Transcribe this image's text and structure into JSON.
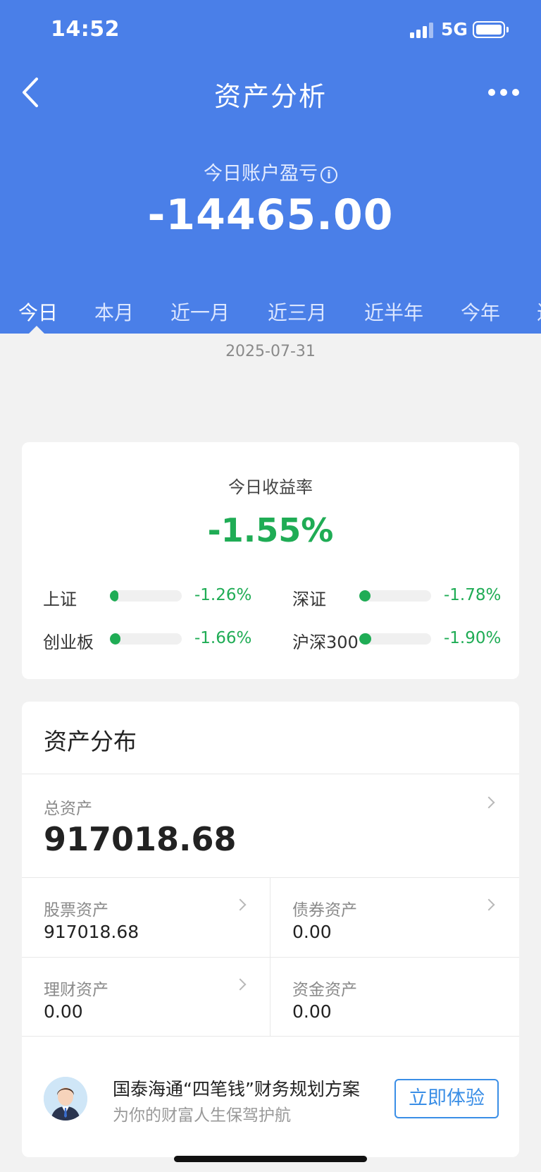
{
  "status_bar": {
    "time": "14:52",
    "network": "5G"
  },
  "nav": {
    "title": "资产分析"
  },
  "summary": {
    "label": "今日账户盈亏",
    "info_icon": "i",
    "value": "-14465.00"
  },
  "tabs": [
    {
      "label": "今日",
      "active": true
    },
    {
      "label": "本月"
    },
    {
      "label": "近一月"
    },
    {
      "label": "近三月"
    },
    {
      "label": "近半年"
    },
    {
      "label": "今年"
    },
    {
      "label": "近"
    }
  ],
  "date": "2025-07-31",
  "yield": {
    "label": "今日收益率",
    "value": "-1.55%",
    "color": "#1fac55",
    "indices": [
      {
        "name": "上证",
        "value": "-1.26%",
        "fill_ratio": 0.12
      },
      {
        "name": "深证",
        "value": "-1.78%",
        "fill_ratio": 0.16
      },
      {
        "name": "创业板",
        "value": "-1.66%",
        "fill_ratio": 0.15
      },
      {
        "name": "沪深300",
        "value": "-1.90%",
        "fill_ratio": 0.17
      }
    ]
  },
  "distribution": {
    "title": "资产分布",
    "total": {
      "label": "总资产",
      "value": "917018.68"
    },
    "cells": [
      {
        "label": "股票资产",
        "value": "917018.68",
        "has_arrow": true
      },
      {
        "label": "债券资产",
        "value": "0.00",
        "has_arrow": true
      },
      {
        "label": "理财资产",
        "value": "0.00",
        "has_arrow": true
      },
      {
        "label": "资金资产",
        "value": "0.00",
        "has_arrow": false
      }
    ]
  },
  "promo": {
    "title": "国泰海通“四笔钱”财务规划方案",
    "subtitle": "为你的财富人生保驾护航",
    "button": "立即体验"
  },
  "colors": {
    "header_bg": "#4a7fe8",
    "accent_blue": "#3a8ee6",
    "down_green": "#1fac55"
  }
}
